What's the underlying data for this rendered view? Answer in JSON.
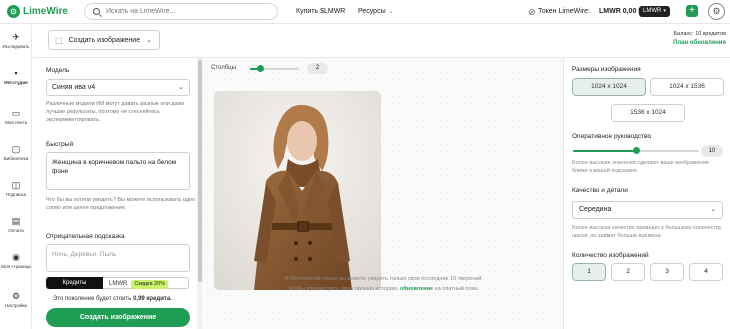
{
  "header": {
    "logo_text": "LimeWire",
    "search_placeholder": "Искать на LimeWire...",
    "buy_label": "Купить $LMWR",
    "resources_label": "Ресурсы",
    "token_label": "Токен LimeWire:",
    "token_value": "LMWR 0,00 $",
    "token_badge": "LMWR"
  },
  "sidebar": {
    "items": [
      {
        "label": "Исследовать",
        "icon": "compass-icon"
      },
      {
        "label": "ИИ-студия",
        "icon": "ai-studio-icon"
      },
      {
        "label": "Моя лента",
        "icon": "feed-icon"
      },
      {
        "label": "Библиотека",
        "icon": "library-icon"
      },
      {
        "label": "Подписка",
        "icon": "subscription-icon"
      },
      {
        "label": "Оплата",
        "icon": "payment-icon"
      },
      {
        "label": "Моя страница",
        "icon": "profile-icon"
      },
      {
        "label": "Настройки",
        "icon": "settings-icon"
      }
    ],
    "active_index": 1
  },
  "subbar": {
    "mode_label": "Создать изображение",
    "balance": "Баланс: 10 кредитов",
    "plan_link": "План обновления"
  },
  "left": {
    "model_label": "Модель",
    "model_value": "Синяя ива v4",
    "model_hint": "Различные модели ИИ могут давать разные или даже лучшие результаты, поэтому не стесняйтесь экспериментировать.",
    "prompt_label": "Быстрый",
    "prompt_value": "Женщина в коричневом пальто на белом фоне",
    "prompt_hint": "Что бы вы хотели увидеть? Вы можете использовать одно слово или целое предложение.",
    "negative_label": "Отрицательная подсказка",
    "negative_placeholder": "Ночь, Деревья, Пыль",
    "credits_tab": "Кредиты",
    "lmwr_tab": "LMWR",
    "discount": "Скидка 20%",
    "cost_prefix": "Это поколение будет стоить",
    "cost_value": "0,99 кредита.",
    "create_button": "Создать изображение"
  },
  "center": {
    "columns_label": "Столбцы",
    "columns_value": "2",
    "columns_slider_fraction": 0.2,
    "note_line1": "В бесплатном плане вы можете увидеть только свои последние 10 творений.",
    "note_line2_prefix": "Чтобы просмотреть свою полную историю,",
    "note_link": "обновление",
    "note_line2_suffix": "на платный план."
  },
  "right": {
    "size_label": "Размеры изображения",
    "sizes": [
      "1024 x 1024",
      "1024 x 1536",
      "1536 x 1024"
    ],
    "selected_size": 0,
    "guidance_label": "Оперативное руководство",
    "guidance_value": "10",
    "guidance_fraction": 0.5,
    "guidance_hint": "Более высокие значения сделают ваше изображение ближе к вашей подсказке.",
    "quality_label": "Качество и детали",
    "quality_value": "Середина",
    "quality_hint": "Более высокое качество приведет к большему количеству шагов, но займет больше времени.",
    "count_label": "Количество изображений",
    "counts": [
      "1",
      "2",
      "3",
      "4"
    ],
    "selected_count": 0
  },
  "colors": {
    "accent": "#1f9d55",
    "discount_bg": "#c9f36b"
  }
}
